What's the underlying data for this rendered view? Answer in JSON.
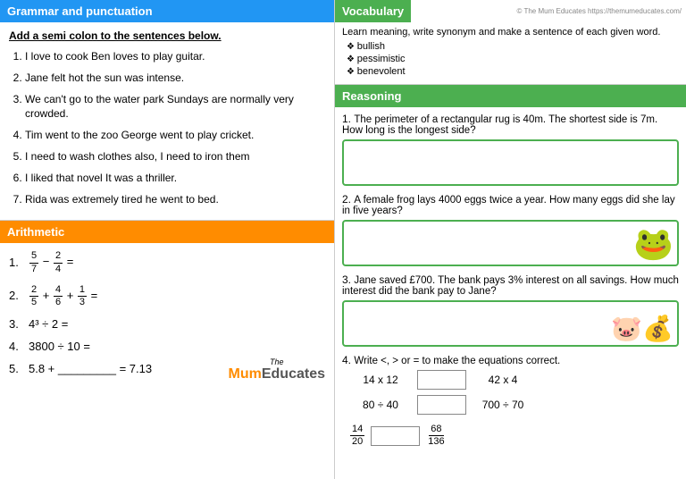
{
  "left": {
    "grammar": {
      "header": "Grammar and punctuation",
      "instruction": "Add a semi colon to the sentences below.",
      "items": [
        "I love to cook Ben loves to play guitar.",
        "Jane felt hot the sun was intense.",
        "We can't go to the water park Sundays are normally very crowded.",
        "Tim went to the zoo George went to play cricket.",
        "I need to wash clothes also, I need to iron them",
        "I liked that novel It was a thriller.",
        "Rida was extremely tired he went to bed."
      ]
    },
    "arithmetic": {
      "header": "Arithmetic",
      "items": [
        {
          "id": 1,
          "latex": "fraction_sub",
          "a_num": "5",
          "a_den": "7",
          "b_num": "2",
          "b_den": "4",
          "op": "−",
          "suffix": "="
        },
        {
          "id": 2,
          "latex": "fraction_add2",
          "a_num": "2",
          "a_den": "5",
          "b_num": "4",
          "b_den": "6",
          "c_num": "1",
          "c_den": "3",
          "suffix": "="
        },
        {
          "id": 3,
          "text": "4³ ÷ 2 ="
        },
        {
          "id": 4,
          "text": "3800 ÷ 10 ="
        },
        {
          "id": 5,
          "text": "5.8 + _________ = 7.13"
        }
      ],
      "logo": {
        "the": "The",
        "mum": "Mum",
        "educates": "Educates"
      }
    }
  },
  "right": {
    "vocab": {
      "header": "Vocabulary",
      "copyright": "© The Mum Educates https://themumeducates.com/",
      "instruction": "Learn meaning, write synonym and make a sentence of each given word.",
      "words": [
        "bullish",
        "pessimistic",
        "benevolent"
      ]
    },
    "reasoning": {
      "header": "Reasoning",
      "questions": [
        {
          "id": 1,
          "text": "The perimeter of a rectangular rug is 40m. The shortest side is 7m. How long is the longest side?"
        },
        {
          "id": 2,
          "text": "A female frog lays 4000 eggs twice a year. How many eggs did she lay in five years?"
        },
        {
          "id": 3,
          "text": "Jane saved £700. The bank pays 3% interest on all savings. How much interest did the bank pay to Jane?"
        },
        {
          "id": 4,
          "text": "Write <, > or = to make the equations correct.",
          "comparisons": [
            {
              "left": "14 x 12",
              "right": "42 x 4"
            },
            {
              "left": "80 ÷ 40",
              "right": "700 ÷ 70"
            }
          ],
          "fractions": [
            {
              "left_num": "14",
              "left_den": "20",
              "right_num": "68",
              "right_den": "136"
            }
          ]
        }
      ]
    }
  }
}
